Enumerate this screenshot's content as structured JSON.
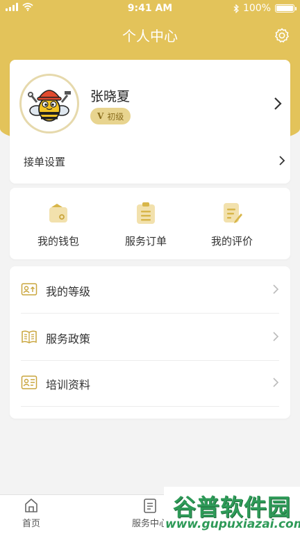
{
  "status_bar": {
    "time": "9:41 AM",
    "battery": "100%",
    "battery_level": 1.0
  },
  "header": {
    "title": "个人中心",
    "settings_icon": "gear-icon"
  },
  "profile": {
    "name": "张晓夏",
    "level_prefix": "V",
    "level": "初级",
    "order_settings": "接单设置"
  },
  "quick_actions": [
    {
      "label": "我的钱包",
      "icon": "wallet-icon"
    },
    {
      "label": "服务订单",
      "icon": "clipboard-icon"
    },
    {
      "label": "我的评价",
      "icon": "review-icon"
    }
  ],
  "menu": [
    {
      "label": "我的等级",
      "icon": "level-card-icon"
    },
    {
      "label": "服务政策",
      "icon": "book-icon"
    },
    {
      "label": "培训资料",
      "icon": "training-icon"
    }
  ],
  "tabbar": [
    {
      "label": "首页",
      "icon": "home-icon"
    },
    {
      "label": "服务中心",
      "icon": "document-icon"
    }
  ],
  "watermark": {
    "title": "谷普软件园",
    "url": "www.gupuxiazai.com"
  },
  "colors": {
    "accent": "#e3c35a",
    "badge": "#e8d48f",
    "icon_gold": "#d8b64a",
    "watermark_green": "#2e9a58"
  }
}
